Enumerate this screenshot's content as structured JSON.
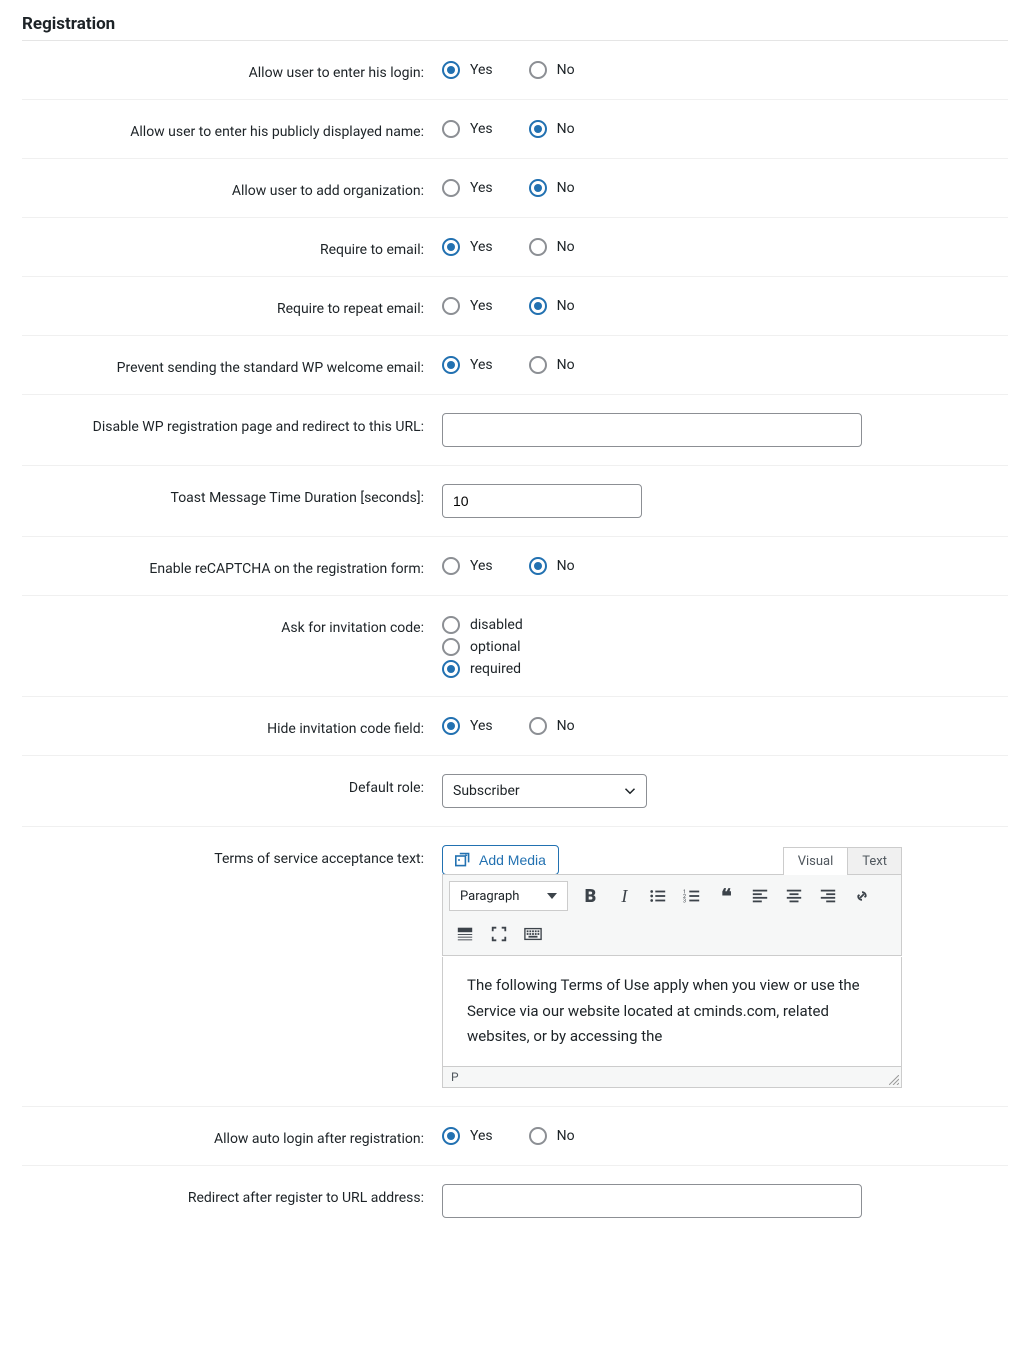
{
  "section_title": "Registration",
  "labels": {
    "yes": "Yes",
    "no": "No"
  },
  "rows": {
    "enter_login": {
      "label": "Allow user to enter his login:",
      "value": "yes"
    },
    "display_name": {
      "label": "Allow user to enter his publicly displayed name:",
      "value": "no"
    },
    "add_org": {
      "label": "Allow user to add organization:",
      "value": "no"
    },
    "require_email": {
      "label": "Require to email:",
      "value": "yes"
    },
    "repeat_email": {
      "label": "Require to repeat email:",
      "value": "no"
    },
    "prevent_welcome": {
      "label": "Prevent sending the standard WP welcome email:",
      "value": "yes"
    },
    "disable_redirect": {
      "label": "Disable WP registration page and redirect to this URL:",
      "value": ""
    },
    "toast_duration": {
      "label": "Toast Message Time Duration [seconds]:",
      "value": "10"
    },
    "recaptcha": {
      "label": "Enable reCAPTCHA on the registration form:",
      "value": "no"
    },
    "invitation": {
      "label": "Ask for invitation code:",
      "options": {
        "disabled": "disabled",
        "optional": "optional",
        "required": "required"
      },
      "value": "required"
    },
    "hide_invitation": {
      "label": "Hide invitation code field:",
      "value": "yes"
    },
    "default_role": {
      "label": "Default role:",
      "value": "Subscriber"
    },
    "tos": {
      "label": "Terms of service acceptance text:",
      "add_media": "Add Media",
      "tabs": {
        "visual": "Visual",
        "text": "Text"
      },
      "format": "Paragraph",
      "body": "The following Terms of Use apply when you view or use the Service via our website located at cminds.com, related websites, or by accessing the",
      "path": "P"
    },
    "auto_login": {
      "label": "Allow auto login after registration:",
      "value": "yes"
    },
    "redirect_after": {
      "label": "Redirect after register to URL address:",
      "value": ""
    }
  }
}
